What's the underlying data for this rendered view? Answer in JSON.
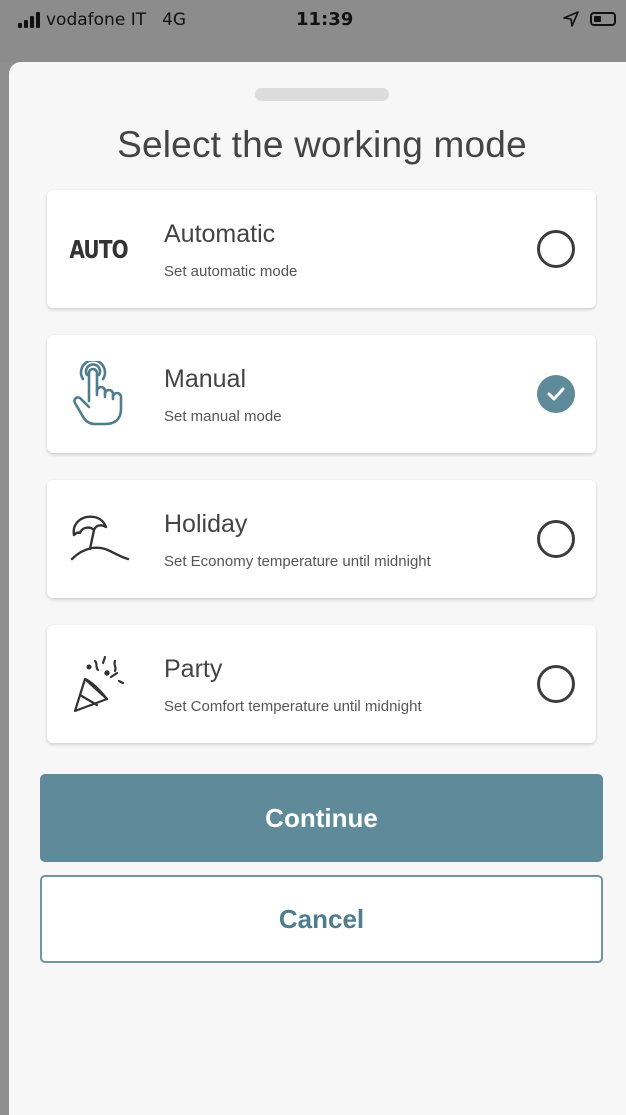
{
  "status_bar": {
    "carrier": "vodafone IT",
    "network": "4G",
    "time": "11:39",
    "location_icon": "location-arrow-icon",
    "battery_icon": "battery-icon"
  },
  "sheet": {
    "title": "Select the working mode"
  },
  "modes": [
    {
      "icon": "auto-text-icon",
      "icon_text": "AUTO",
      "title": "Automatic",
      "description": "Set automatic mode",
      "selected": false
    },
    {
      "icon": "hand-tap-icon",
      "title": "Manual",
      "description": "Set manual mode",
      "selected": true
    },
    {
      "icon": "beach-umbrella-icon",
      "title": "Holiday",
      "description": "Set Economy temperature until midnight",
      "selected": false
    },
    {
      "icon": "party-popper-icon",
      "title": "Party",
      "description": "Set Comfort temperature until midnight",
      "selected": false
    }
  ],
  "buttons": {
    "continue_label": "Continue",
    "cancel_label": "Cancel"
  },
  "colors": {
    "accent": "#5e8a99",
    "icon_stroke": "#4f7d8d"
  }
}
